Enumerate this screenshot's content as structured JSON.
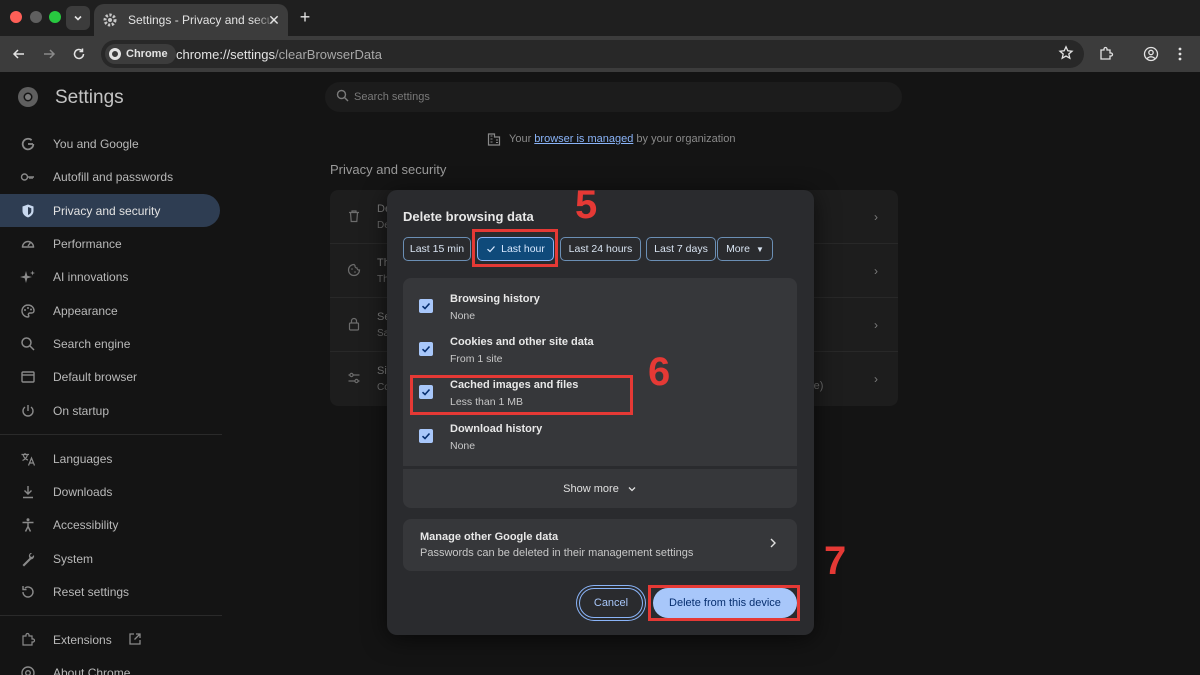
{
  "browser": {
    "tab_title": "Settings - Privacy and security",
    "chip_label": "Chrome",
    "url_host": "chrome://settings",
    "url_path": "/clearBrowserData"
  },
  "settings": {
    "title": "Settings",
    "search_placeholder": "Search settings",
    "managed_prefix": "Your ",
    "managed_link": "browser is managed",
    "managed_suffix": " by your organization",
    "section_title": "Privacy and security",
    "nav": [
      {
        "label": "You and Google",
        "icon": "google-icon"
      },
      {
        "label": "Autofill and passwords",
        "icon": "key-icon"
      },
      {
        "label": "Privacy and security",
        "icon": "shield-icon",
        "active": true
      },
      {
        "label": "Performance",
        "icon": "speedometer-icon"
      },
      {
        "label": "AI innovations",
        "icon": "sparkle-icon"
      },
      {
        "label": "Appearance",
        "icon": "palette-icon"
      },
      {
        "label": "Search engine",
        "icon": "search-icon"
      },
      {
        "label": "Default browser",
        "icon": "browser-window-icon"
      },
      {
        "label": "On startup",
        "icon": "power-icon"
      },
      {
        "label": "Languages",
        "icon": "translate-icon"
      },
      {
        "label": "Downloads",
        "icon": "download-icon"
      },
      {
        "label": "Accessibility",
        "icon": "accessibility-icon"
      },
      {
        "label": "System",
        "icon": "wrench-icon"
      },
      {
        "label": "Reset settings",
        "icon": "reset-icon"
      },
      {
        "label": "Extensions",
        "icon": "puzzle-icon"
      },
      {
        "label": "About Chrome",
        "icon": "chrome-icon"
      }
    ],
    "card_rows": [
      {
        "title": "De",
        "sub": "De",
        "icon": "trash-icon"
      },
      {
        "title": "Th",
        "sub": "Th",
        "icon": "cookie-icon"
      },
      {
        "title": "Se",
        "sub": "Sa",
        "icon": "lock-icon"
      },
      {
        "title": "Si",
        "sub": "Co",
        "icon": "sliders-icon"
      }
    ],
    "card_ghost": "re)"
  },
  "dialog": {
    "title": "Delete browsing data",
    "time_ranges": [
      "Last 15 min",
      "Last hour",
      "Last 24 hours",
      "Last 7 days",
      "More"
    ],
    "selected_range": "Last hour",
    "items": [
      {
        "title": "Browsing history",
        "sub": "None",
        "checked": true
      },
      {
        "title": "Cookies and other site data",
        "sub": "From 1 site",
        "checked": true
      },
      {
        "title": "Cached images and files",
        "sub": "Less than 1 MB",
        "checked": true
      },
      {
        "title": "Download history",
        "sub": "None",
        "checked": true
      }
    ],
    "show_more": "Show more",
    "manage_title": "Manage other Google data",
    "manage_sub": "Passwords can be deleted in their management settings",
    "cancel_label": "Cancel",
    "delete_label": "Delete from this device"
  },
  "annotations": {
    "step5": "5",
    "step6": "6",
    "step7": "7",
    "color": "#e53935"
  }
}
